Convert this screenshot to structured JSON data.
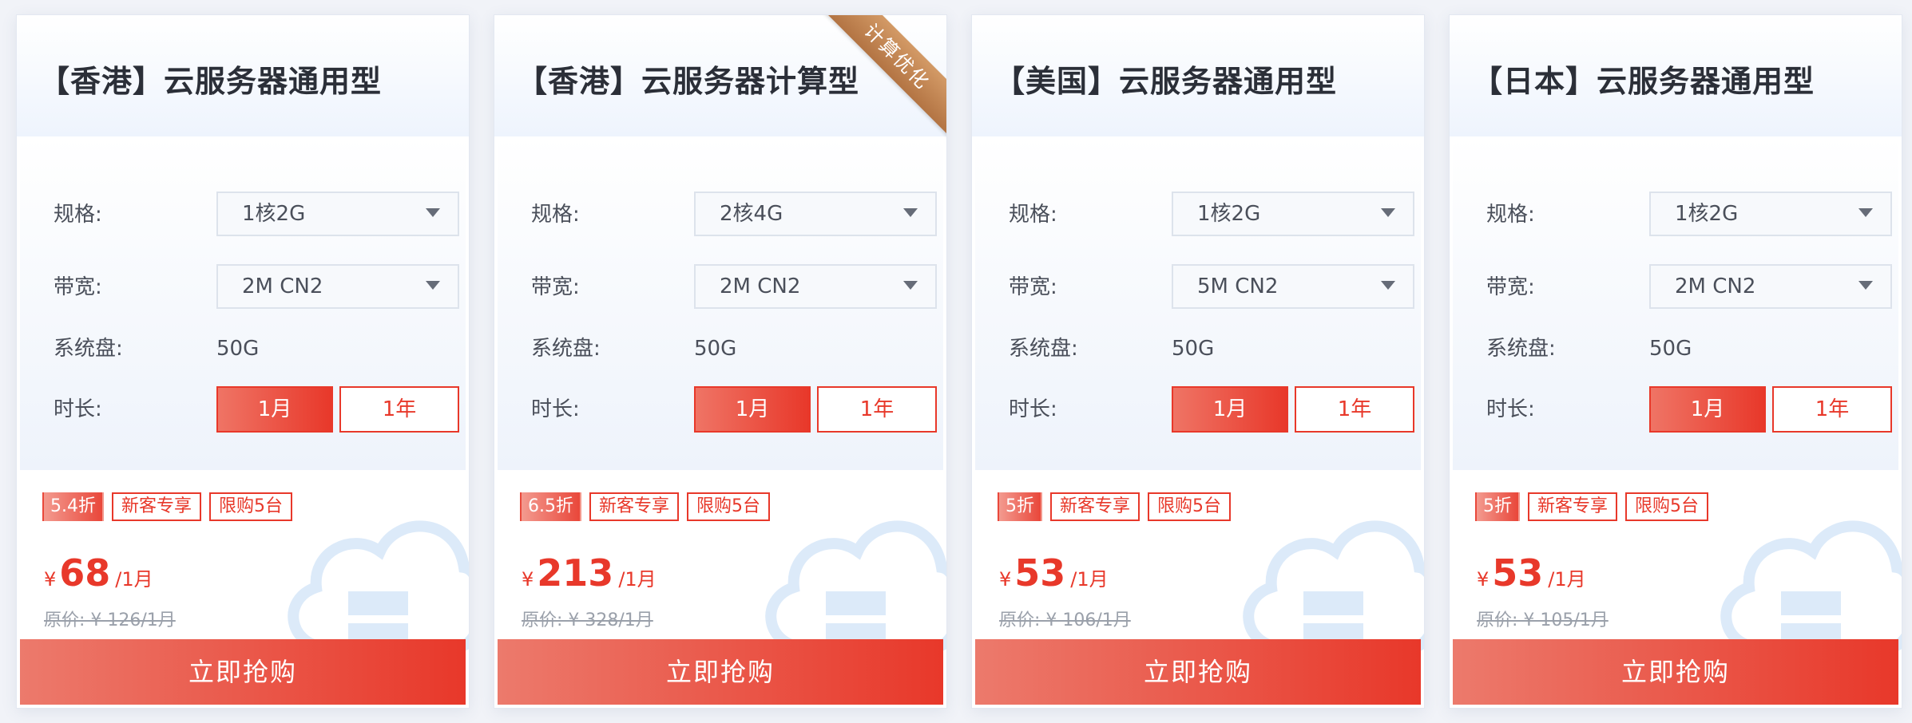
{
  "labels": {
    "spec": "规格:",
    "bandwidth": "带宽:",
    "disk": "系统盘:",
    "duration": "时长:",
    "month": "1月",
    "year": "1年",
    "new_customer": "新客专享",
    "limit": "限购5台",
    "yen": "¥",
    "per_month": "/1月",
    "buy": "立即抢购"
  },
  "cards": [
    {
      "title": "【香港】云服务器通用型",
      "spec": "1核2G",
      "bandwidth": "2M CN2",
      "disk": "50G",
      "discount": "5.4折",
      "price": "68",
      "original_price": "原价: ¥ 126/1月",
      "ribbon": ""
    },
    {
      "title": "【香港】云服务器计算型",
      "spec": "2核4G",
      "bandwidth": "2M CN2",
      "disk": "50G",
      "discount": "6.5折",
      "price": "213",
      "original_price": "原价: ¥ 328/1月",
      "ribbon": "计算优化"
    },
    {
      "title": "【美国】云服务器通用型",
      "spec": "1核2G",
      "bandwidth": "5M CN2",
      "disk": "50G",
      "discount": "5折",
      "price": "53",
      "original_price": "原价: ¥ 106/1月",
      "ribbon": ""
    },
    {
      "title": "【日本】云服务器通用型",
      "spec": "1核2G",
      "bandwidth": "2M CN2",
      "disk": "50G",
      "discount": "5折",
      "price": "53",
      "original_price": "原价: ¥ 105/1月",
      "ribbon": ""
    }
  ],
  "colors": {
    "accent": "#e8382a",
    "ribbon": "#c08050",
    "cloud": "#dceaf9"
  },
  "icons": {
    "background": "cloud-icon",
    "dropdown": "chevron-down-icon"
  }
}
